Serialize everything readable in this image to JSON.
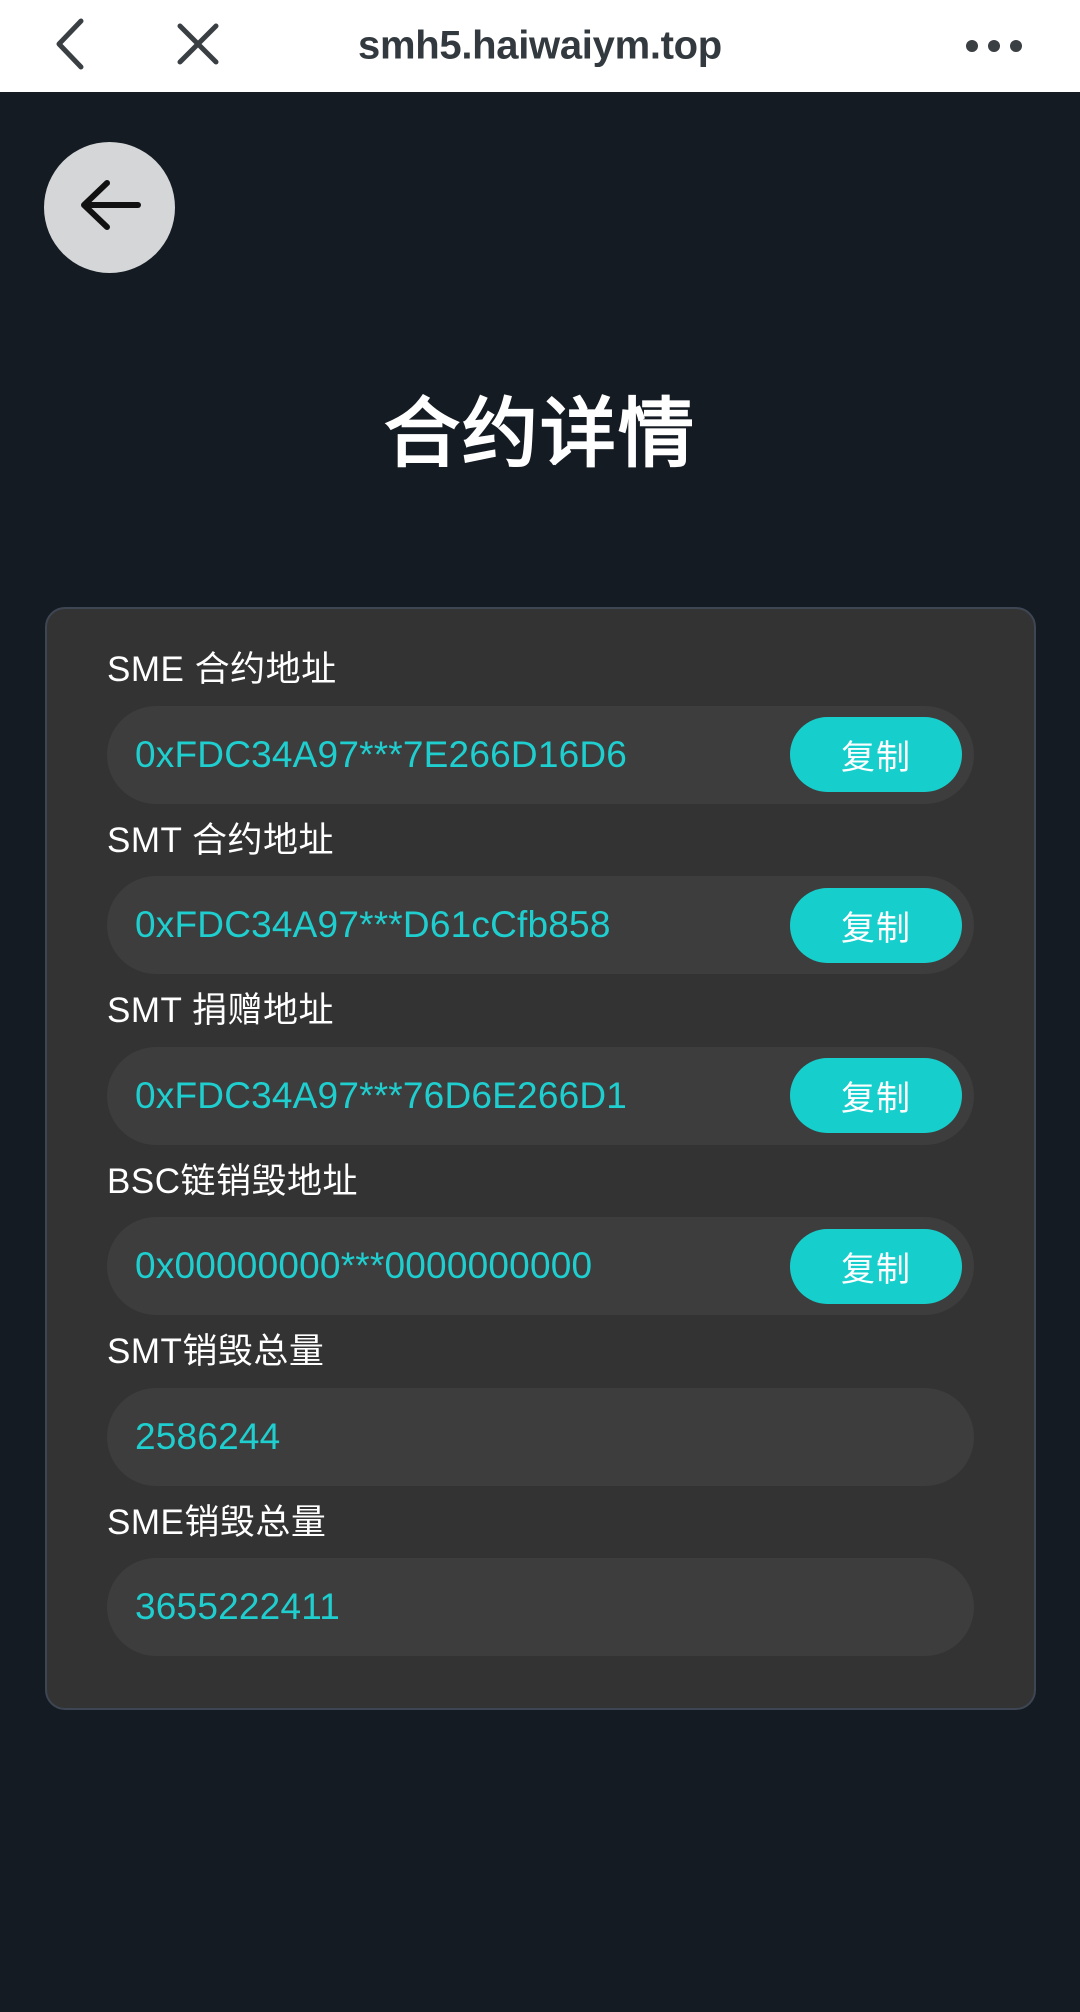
{
  "browser": {
    "url": "smh5.haiwaiym.top",
    "back_icon": "chevron-left-icon",
    "close_icon": "close-icon",
    "menu_icon": "more-options-icon"
  },
  "page": {
    "back_button_icon": "arrow-left-icon",
    "title": "合约详情",
    "background_color": "#141b23",
    "card_color": "#333333",
    "field_color": "#3d3d3d",
    "accent_color": "#1fcfcf",
    "button_color": "#16cfcd"
  },
  "fields": [
    {
      "label": "SME 合约地址",
      "value": "0xFDC34A97***7E266D16D6",
      "copy_label": "复制",
      "has_copy": true
    },
    {
      "label": "SMT 合约地址",
      "value": "0xFDC34A97***D61cCfb858",
      "copy_label": "复制",
      "has_copy": true
    },
    {
      "label": "SMT 捐赠地址",
      "value": "0xFDC34A97***76D6E266D1",
      "copy_label": "复制",
      "has_copy": true
    },
    {
      "label": "BSC链销毁地址",
      "value": "0x00000000***0000000000",
      "copy_label": "复制",
      "has_copy": true
    },
    {
      "label": "SMT销毁总量",
      "value": "2586244",
      "copy_label": "",
      "has_copy": false
    },
    {
      "label": "SME销毁总量",
      "value": "3655222411",
      "copy_label": "",
      "has_copy": false
    }
  ]
}
